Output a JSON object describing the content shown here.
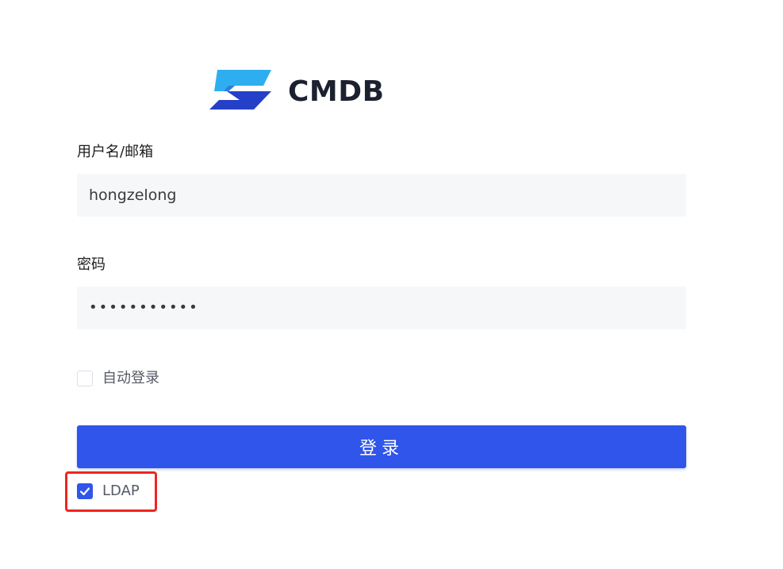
{
  "brand": {
    "name": "CMDB",
    "logo_colors": {
      "top": "#2eaef0",
      "bottom": "#2440c8"
    }
  },
  "form": {
    "username_label": "用户名/邮箱",
    "username_value": "hongzelong",
    "password_label": "密码",
    "password_value": "•••••••••••",
    "auto_login_label": "自动登录",
    "auto_login_checked": false,
    "submit_label": "登录",
    "ldap_label": "LDAP",
    "ldap_checked": true
  },
  "colors": {
    "primary": "#2f55eb",
    "input_bg": "#f6f7f9",
    "highlight": "#f0251f"
  }
}
